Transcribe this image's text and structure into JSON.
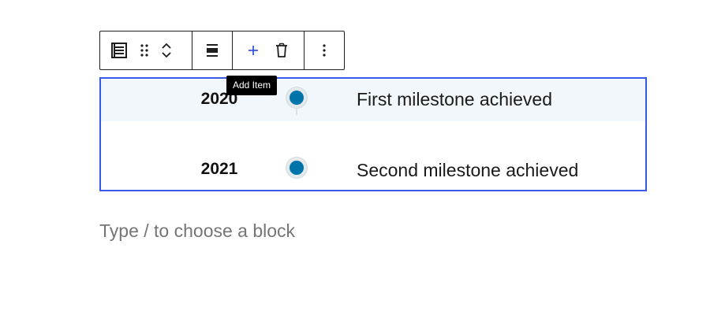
{
  "toolbar": {
    "buttons": [
      {
        "name": "block-type",
        "icon": "list-view-icon"
      },
      {
        "name": "drag",
        "icon": "drag-handle-icon"
      },
      {
        "name": "move-up",
        "icon": "chevron-up-icon"
      },
      {
        "name": "move-down",
        "icon": "chevron-down-icon"
      },
      {
        "name": "align",
        "icon": "align-icon"
      },
      {
        "name": "add-item",
        "icon": "plus-icon"
      },
      {
        "name": "delete",
        "icon": "trash-icon"
      },
      {
        "name": "options",
        "icon": "more-vertical-icon"
      }
    ],
    "accent_color": "#3858e9"
  },
  "tooltip": {
    "text": "Add Item"
  },
  "timeline": {
    "border_color": "#3858e9",
    "dot_color": "#0073aa",
    "items": [
      {
        "year": "2020",
        "text": "First milestone achieved"
      },
      {
        "year": "2021",
        "text": "Second milestone achieved"
      }
    ]
  },
  "editor": {
    "placeholder": "Type / to choose a block"
  }
}
